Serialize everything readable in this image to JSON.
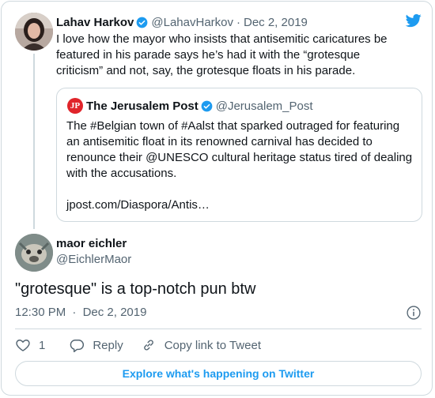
{
  "colors": {
    "accent": "#1d9bf0",
    "muted": "#536471",
    "border": "#cfd9de",
    "like_icon": "#536471"
  },
  "icons": [
    "twitter-bird-icon",
    "verified-badge-icon",
    "info-icon",
    "heart-icon",
    "reply-icon",
    "link-icon"
  ],
  "parent_tweet": {
    "author_name": "Lahav Harkov",
    "handle": "@LahavHarkov",
    "date": "Dec 2, 2019",
    "text": "I love how the mayor who insists that antisemitic caricatures be featured in his parade says he’s had it with the “grotesque criticism” and not, say, the grotesque floats in his parade.",
    "quoted": {
      "logo_text": "JP",
      "author_name": "The Jerusalem Post",
      "handle": "@Jerusalem_Post",
      "text": "The #Belgian town of #Aalst that sparked outraged for featuring an antisemitic float in its renowned carnival has decided to renounce their @UNESCO cultural heritage status tired of dealing with the accusations.",
      "link": "jpost.com/Diaspora/Antis…"
    }
  },
  "tweet": {
    "author_name": "maor eichler",
    "handle": "@EichlerMaor",
    "text": "\"grotesque\" is a top-notch pun btw",
    "time": "12:30 PM",
    "date": "Dec 2, 2019",
    "separator": "·"
  },
  "actions": {
    "like_count": "1",
    "reply_label": "Reply",
    "copy_link_label": "Copy link to Tweet"
  },
  "explore_label": "Explore what's happening on Twitter"
}
